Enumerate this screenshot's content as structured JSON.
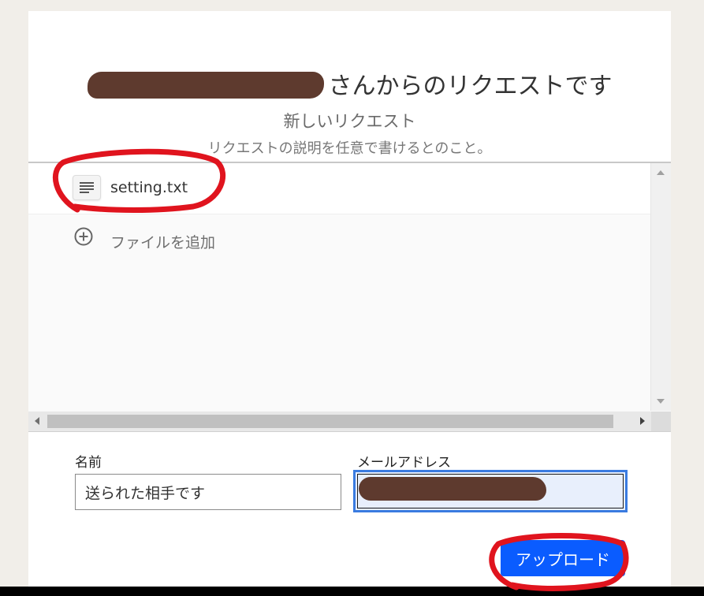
{
  "header": {
    "title_suffix": "さんからのリクエストです",
    "subtitle": "新しいリクエスト",
    "description": "リクエストの説明を任意で書けるとのこと。"
  },
  "files": {
    "items": [
      {
        "name": "setting.txt",
        "icon": "text-file-icon"
      }
    ],
    "add_label": "ファイルを追加",
    "add_icon": "plus-circle-icon"
  },
  "form": {
    "name_label": "名前",
    "name_value": "送られた相手です",
    "email_label": "メールアドレス",
    "email_value": ""
  },
  "actions": {
    "upload_label": "アップロード"
  },
  "colors": {
    "accent": "#0a5cff",
    "redaction": "#5e3a2e",
    "annotation": "#e0141e",
    "focus_border": "#3a7be0"
  }
}
